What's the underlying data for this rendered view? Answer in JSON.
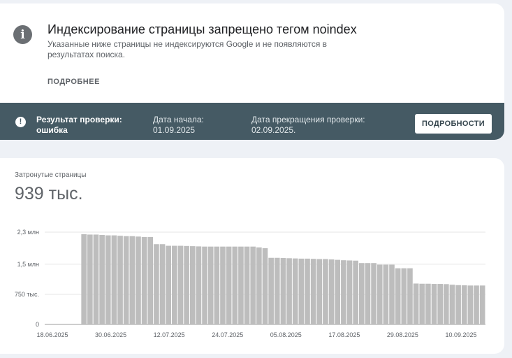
{
  "issue": {
    "title": "Индексирование страницы запрещено тегом noindex",
    "description": "Указанные ниже страницы не индексируются Google и не появляются в результатах поиска.",
    "more_link": "ПОДРОБНЕЕ",
    "icon": "info-icon"
  },
  "validation": {
    "status_label": "Результат проверки: ошибка",
    "start_date": "Дата начала: 01.09.2025",
    "end_date": "Дата прекращения проверки: 02.09.2025.",
    "details_button": "ПОДРОБНОСТИ",
    "icon": "alert-icon"
  },
  "summary": {
    "label": "Затронутые страницы",
    "value": "939 тыс."
  },
  "colors": {
    "status_bar": "#455a64",
    "bars": "#bdbdbd"
  },
  "chart_data": {
    "type": "bar",
    "ytick_labels": [
      "0",
      "750 тыс.",
      "1,5 млн",
      "2,3 млн"
    ],
    "yticks": [
      0,
      750000,
      1500000,
      2300000
    ],
    "ylim": [
      0,
      2300000
    ],
    "xtick_labels": [
      "18.06.2025",
      "30.06.2025",
      "12.07.2025",
      "24.07.2025",
      "05.08.2025",
      "17.08.2025",
      "29.08.2025",
      "10.09.2025"
    ],
    "x_start": "18.06.2025",
    "x_end": "10.09.2025",
    "values": [
      0,
      0,
      0,
      0,
      0,
      0,
      2250000,
      2240000,
      2240000,
      2230000,
      2220000,
      2220000,
      2210000,
      2200000,
      2200000,
      2190000,
      2180000,
      2180000,
      2000000,
      2000000,
      1960000,
      1960000,
      1960000,
      1955000,
      1950000,
      1945000,
      1940000,
      1940000,
      1940000,
      1940000,
      1940000,
      1940000,
      1940000,
      1940000,
      1940000,
      1920000,
      1900000,
      1660000,
      1660000,
      1655000,
      1650000,
      1645000,
      1640000,
      1640000,
      1635000,
      1630000,
      1630000,
      1620000,
      1610000,
      1600000,
      1595000,
      1590000,
      1530000,
      1530000,
      1530000,
      1490000,
      1490000,
      1490000,
      1400000,
      1400000,
      1400000,
      1020000,
      1015000,
      1015000,
      1010000,
      1010000,
      1005000,
      990000,
      980000,
      975000,
      970000,
      970000,
      970000
    ]
  }
}
